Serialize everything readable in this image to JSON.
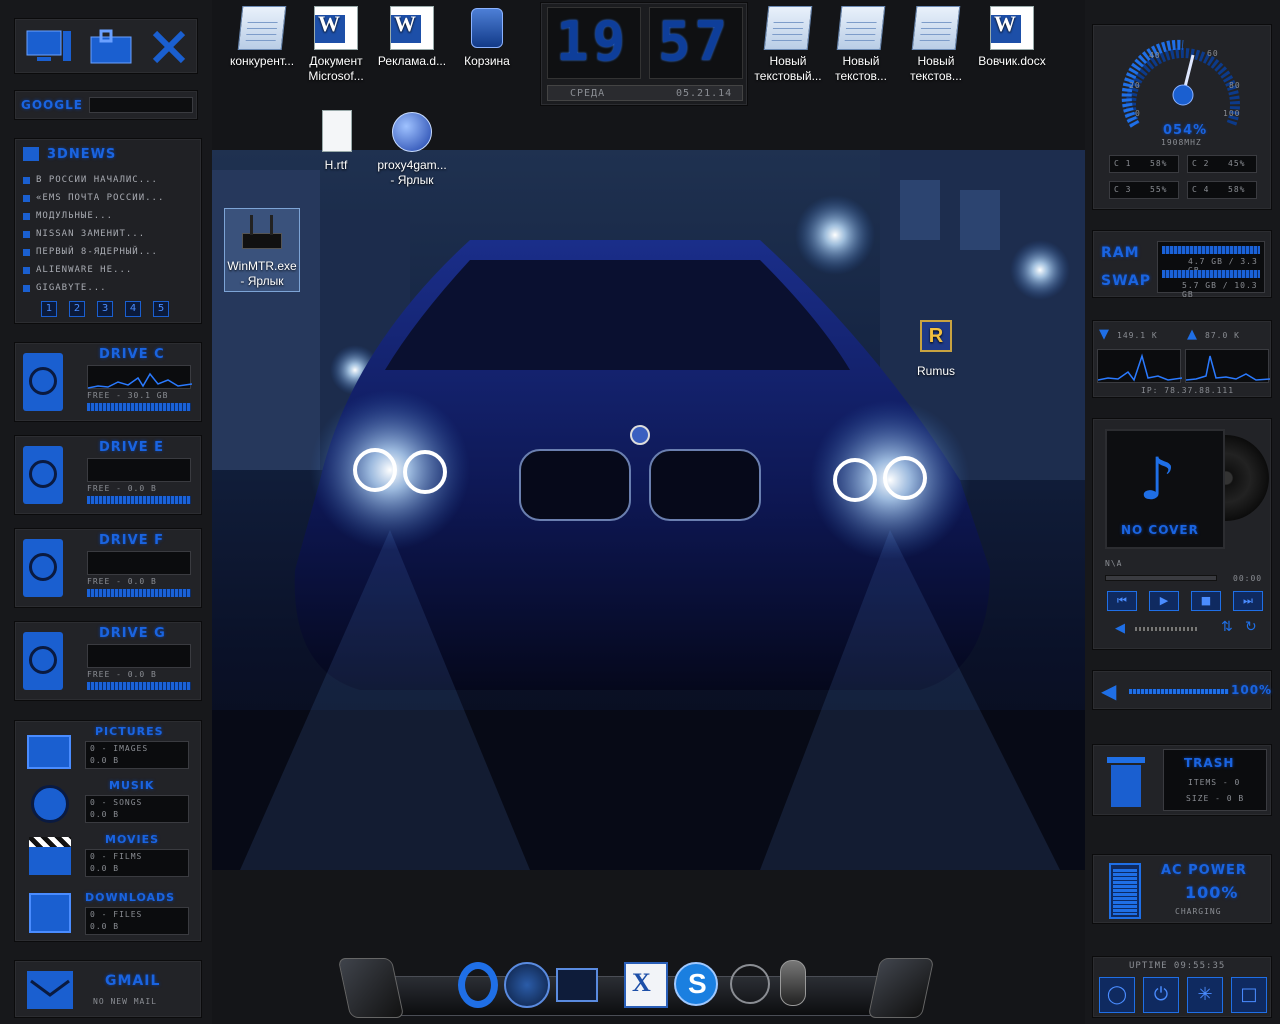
{
  "desktop_icons": [
    {
      "label": "конкурент...",
      "type": "notepad"
    },
    {
      "label": "Документ Microsof...",
      "type": "word"
    },
    {
      "label": "Реклама.d...",
      "type": "word"
    },
    {
      "label": "Корзина",
      "type": "recycle-bin"
    },
    {
      "label": "Новый текстовый...",
      "type": "notepad"
    },
    {
      "label": "Новый текстов...",
      "type": "notepad"
    },
    {
      "label": "Новый текстов...",
      "type": "notepad"
    },
    {
      "label": "Вовчик.docx",
      "type": "word"
    },
    {
      "label": "H.rtf",
      "type": "document"
    },
    {
      "label": "proxy4gam... - Ярлык",
      "type": "globe"
    },
    {
      "label": "WinMTR.exe - Ярлык",
      "type": "router"
    },
    {
      "label": "Rumus",
      "type": "rumus"
    }
  ],
  "clock": {
    "hours": "19",
    "minutes": "57",
    "day": "СРЕДА",
    "date": "05.21.14"
  },
  "google": {
    "label": "GOOGLE",
    "placeholder": ""
  },
  "news": {
    "title": "3DNEWS",
    "items": [
      "В РОССИИ НАЧАЛИС...",
      "«EMS ПОЧТА РОССИИ...",
      "МОДУЛЬНЫЕ...",
      "NISSAN ЗАМЕНИТ...",
      "ПЕРВЫЙ 8-ЯДЕРНЫЙ...",
      "ALIENWARE HE...",
      "GIGABYTE..."
    ],
    "pages": [
      "1",
      "2",
      "3",
      "4",
      "5"
    ]
  },
  "drives": [
    {
      "name": "DRIVE C",
      "free": "FREE - 30.1 GB"
    },
    {
      "name": "DRIVE E",
      "free": "FREE - 0.0 B"
    },
    {
      "name": "DRIVE F",
      "free": "FREE - 0.0 B"
    },
    {
      "name": "DRIVE G",
      "free": "FREE - 0.0 B"
    }
  ],
  "folders": [
    {
      "name": "PICTURES",
      "count": "0 - IMAGES",
      "size": "0.0 B"
    },
    {
      "name": "MUSIK",
      "count": "0 - SONGS",
      "size": "0.0 B"
    },
    {
      "name": "MOVIES",
      "count": "0 - FILMS",
      "size": "0.0 B"
    },
    {
      "name": "DOWNLOADS",
      "count": "0 - FILES",
      "size": "0.0 B"
    }
  ],
  "gmail": {
    "title": "GMAIL",
    "status": "NO NEW MAIL"
  },
  "cpu": {
    "gauge_labels": [
      "0",
      "20",
      "40",
      "60",
      "80",
      "100"
    ],
    "percent": "054%",
    "freq": "1908MHZ",
    "cores": [
      {
        "name": "C 1",
        "value": "58%"
      },
      {
        "name": "C 2",
        "value": "45%"
      },
      {
        "name": "C 3",
        "value": "55%"
      },
      {
        "name": "C 4",
        "value": "58%"
      }
    ]
  },
  "memory": {
    "ram_label": "RAM",
    "swap_label": "SWAP",
    "ram_value": "4.7 GB / 3.3 GB",
    "swap_value": "5.7 GB / 10.3 GB"
  },
  "network": {
    "down": "149.1 K",
    "up": "87.0 K",
    "ip": "IP: 78.37.88.111"
  },
  "player": {
    "cover": "NO COVER",
    "track": "N\\A",
    "time": "00:00"
  },
  "volume": {
    "value": "100%"
  },
  "trash": {
    "title": "TRASH",
    "items": "ITEMS - 0",
    "size": "SIZE - 0 B"
  },
  "power": {
    "title": "AC POWER",
    "percent": "100%",
    "status": "CHARGING"
  },
  "uptime": {
    "label": "UPTIME 09:55:35"
  },
  "colors": {
    "accent": "#1f6fe6",
    "panel": "#222327",
    "bar": "#17181b"
  }
}
